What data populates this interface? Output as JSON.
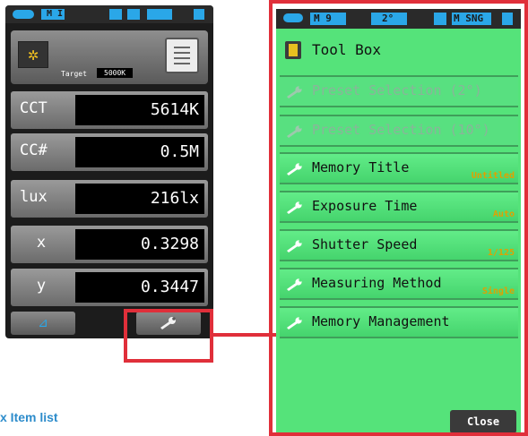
{
  "left_screen": {
    "status_text": "M I",
    "header": {
      "icon": "star-icon",
      "target_label": "Target",
      "target_value": "5000K",
      "notebook_icon": "notebook-icon"
    },
    "rows": [
      {
        "label": "CCT",
        "value": "5614K"
      },
      {
        "label": "CC#",
        "value": "0.5M"
      },
      {
        "label": "lux",
        "value": "216lx"
      },
      {
        "label": "x",
        "value": "0.3298"
      },
      {
        "label": "y",
        "value": "0.3447"
      }
    ],
    "bottom_buttons": [
      {
        "icon": "delta-icon",
        "glyph": "⊿"
      },
      {
        "icon": "wrench-icon",
        "glyph": "🔧"
      }
    ]
  },
  "caption": "x Item list",
  "right_screen": {
    "status": {
      "mode": "M 9",
      "angle": "2°",
      "sng": "M SNG"
    },
    "title": "Tool Box",
    "items": [
      {
        "label": "Preset Selection (2°)",
        "sub": "",
        "enabled": false
      },
      {
        "label": "Preset Selection (10°)",
        "sub": "",
        "enabled": false
      },
      {
        "label": "Memory Title",
        "sub": "Untitled",
        "enabled": true
      },
      {
        "label": "Exposure Time",
        "sub": "Auto",
        "enabled": true
      },
      {
        "label": "Shutter Speed",
        "sub": "1/125",
        "enabled": true
      },
      {
        "label": "Measuring Method",
        "sub": "Single",
        "enabled": true
      },
      {
        "label": "Memory Management",
        "sub": "",
        "enabled": true
      }
    ],
    "close_label": "Close"
  },
  "colors": {
    "accent_blue": "#2aa7e8",
    "highlight_red": "#e02f3a",
    "toolbox_green": "#55e37a",
    "sub_orange": "#e0a000"
  }
}
